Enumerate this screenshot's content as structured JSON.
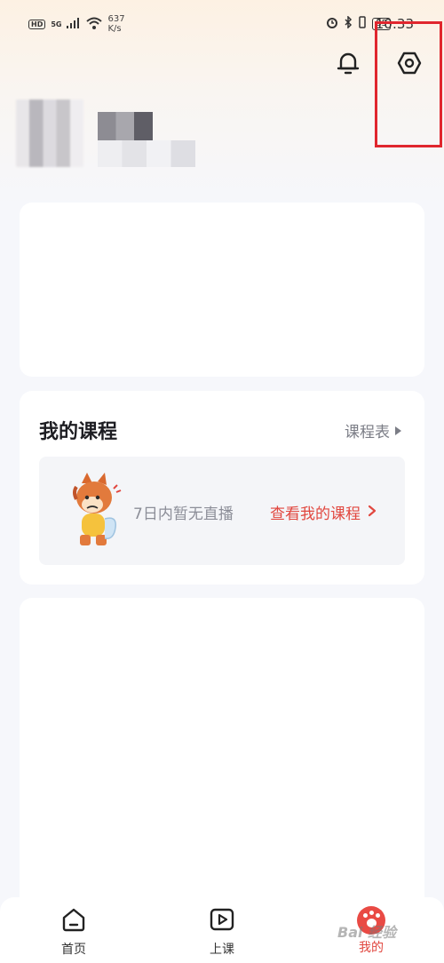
{
  "status_bar": {
    "hd": "HD",
    "signal": "5G",
    "net_speed_value": "637",
    "net_speed_unit": "K/s",
    "battery": "85",
    "time": "10:33"
  },
  "courses": {
    "title": "我的课程",
    "schedule_label": "课程表",
    "empty_text": "7日内暂无直播",
    "view_courses_label": "查看我的课程"
  },
  "tabs": [
    {
      "label": "首页"
    },
    {
      "label": "上课"
    },
    {
      "label": "我的"
    }
  ],
  "watermark": "Bai 经验",
  "colors": {
    "accent": "#e1473f",
    "highlight": "#e0262e"
  },
  "icons": [
    "bell-icon",
    "settings-icon",
    "home-icon",
    "play-icon",
    "mine-paw-icon",
    "chevron-right-icon"
  ]
}
